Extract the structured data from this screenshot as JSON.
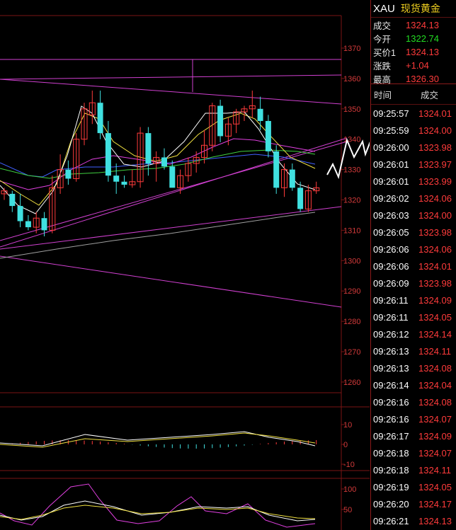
{
  "header": {
    "symbol": "XAU",
    "name": "现货黄金"
  },
  "quotes": [
    {
      "label": "成交",
      "value": "1324.13",
      "color": "#ff3b3b"
    },
    {
      "label": "今开",
      "value": "1322.74",
      "color": "#22dd22"
    },
    {
      "label": "买价1",
      "value": "1324.13",
      "color": "#ff3b3b"
    },
    {
      "label": "涨跌",
      "value": "+1.04",
      "color": "#ff3b3b"
    },
    {
      "label": "最高",
      "value": "1326.30",
      "color": "#ff3b3b"
    }
  ],
  "trades_header": {
    "time": "时间",
    "price": "成交"
  },
  "trades": [
    {
      "time": "09:25:57",
      "price": "1324.01"
    },
    {
      "time": "09:25:59",
      "price": "1324.00"
    },
    {
      "time": "09:26:00",
      "price": "1323.98"
    },
    {
      "time": "09:26:01",
      "price": "1323.97"
    },
    {
      "time": "09:26:01",
      "price": "1323.99"
    },
    {
      "time": "09:26:02",
      "price": "1324.06"
    },
    {
      "time": "09:26:03",
      "price": "1324.00"
    },
    {
      "time": "09:26:05",
      "price": "1323.98"
    },
    {
      "time": "09:26:06",
      "price": "1324.06"
    },
    {
      "time": "09:26:06",
      "price": "1324.01"
    },
    {
      "time": "09:26:09",
      "price": "1323.98"
    },
    {
      "time": "09:26:11",
      "price": "1324.09"
    },
    {
      "time": "09:26:11",
      "price": "1324.05"
    },
    {
      "time": "09:26:12",
      "price": "1324.14"
    },
    {
      "time": "09:26:13",
      "price": "1324.11"
    },
    {
      "time": "09:26:13",
      "price": "1324.08"
    },
    {
      "time": "09:26:14",
      "price": "1324.04"
    },
    {
      "time": "09:26:16",
      "price": "1324.08"
    },
    {
      "time": "09:26:16",
      "price": "1324.07"
    },
    {
      "time": "09:26:17",
      "price": "1324.09"
    },
    {
      "time": "09:26:18",
      "price": "1324.07"
    },
    {
      "time": "09:26:18",
      "price": "1324.11"
    },
    {
      "time": "09:26:19",
      "price": "1324.05"
    },
    {
      "time": "09:26:20",
      "price": "1324.17"
    },
    {
      "time": "09:26:21",
      "price": "1324.13"
    }
  ],
  "chart_data": {
    "type": "candlestick",
    "price_axis": {
      "ticks": [
        1370,
        1360,
        1350,
        1340,
        1330,
        1320,
        1310,
        1300,
        1290,
        1280,
        1270,
        1260
      ],
      "ylim": [
        1255,
        1378
      ]
    },
    "macd_axis": {
      "ticks": [
        10,
        0,
        -10
      ]
    },
    "osc_axis": {
      "ticks": [
        100,
        50
      ]
    },
    "colors": {
      "up": "#ff3b3b",
      "down": "#40e0e0",
      "grid": "#7a1515",
      "ma_white": "#ffffff",
      "ma_yellow": "#f0e040",
      "ma_green": "#40d040",
      "ma_blue": "#4060ff",
      "ma_magenta": "#e040e0",
      "ma_gray": "#a0a0a0",
      "trend": "#d040d0"
    },
    "candles": [
      {
        "o": 1322,
        "h": 1324,
        "l": 1320,
        "c": 1323
      },
      {
        "o": 1322,
        "h": 1323,
        "l": 1316,
        "c": 1318
      },
      {
        "o": 1318,
        "h": 1322,
        "l": 1311,
        "c": 1313
      },
      {
        "o": 1313,
        "h": 1315,
        "l": 1310,
        "c": 1311
      },
      {
        "o": 1311,
        "h": 1316,
        "l": 1309,
        "c": 1314
      },
      {
        "o": 1314,
        "h": 1316,
        "l": 1308,
        "c": 1310
      },
      {
        "o": 1310,
        "h": 1328,
        "l": 1309,
        "c": 1324
      },
      {
        "o": 1324,
        "h": 1335,
        "l": 1322,
        "c": 1330
      },
      {
        "o": 1330,
        "h": 1333,
        "l": 1325,
        "c": 1327
      },
      {
        "o": 1327,
        "h": 1342,
        "l": 1326,
        "c": 1340
      },
      {
        "o": 1340,
        "h": 1352,
        "l": 1338,
        "c": 1350
      },
      {
        "o": 1348,
        "h": 1356,
        "l": 1345,
        "c": 1352
      },
      {
        "o": 1352,
        "h": 1356,
        "l": 1340,
        "c": 1342
      },
      {
        "o": 1342,
        "h": 1346,
        "l": 1326,
        "c": 1328
      },
      {
        "o": 1328,
        "h": 1332,
        "l": 1322,
        "c": 1326
      },
      {
        "o": 1326,
        "h": 1328,
        "l": 1324,
        "c": 1325
      },
      {
        "o": 1325,
        "h": 1330,
        "l": 1324,
        "c": 1326
      },
      {
        "o": 1326,
        "h": 1344,
        "l": 1324,
        "c": 1342
      },
      {
        "o": 1342,
        "h": 1344,
        "l": 1328,
        "c": 1332
      },
      {
        "o": 1332,
        "h": 1336,
        "l": 1326,
        "c": 1334
      },
      {
        "o": 1334,
        "h": 1337,
        "l": 1330,
        "c": 1331
      },
      {
        "o": 1331,
        "h": 1333,
        "l": 1326,
        "c": 1324
      },
      {
        "o": 1324,
        "h": 1330,
        "l": 1322,
        "c": 1328
      },
      {
        "o": 1328,
        "h": 1334,
        "l": 1326,
        "c": 1332
      },
      {
        "o": 1332,
        "h": 1336,
        "l": 1329,
        "c": 1334
      },
      {
        "o": 1334,
        "h": 1343,
        "l": 1332,
        "c": 1338
      },
      {
        "o": 1338,
        "h": 1352,
        "l": 1336,
        "c": 1351
      },
      {
        "o": 1351,
        "h": 1353,
        "l": 1339,
        "c": 1341
      },
      {
        "o": 1341,
        "h": 1347,
        "l": 1338,
        "c": 1345
      },
      {
        "o": 1345,
        "h": 1350,
        "l": 1342,
        "c": 1349
      },
      {
        "o": 1349,
        "h": 1351,
        "l": 1346,
        "c": 1350
      },
      {
        "o": 1350,
        "h": 1356,
        "l": 1347,
        "c": 1351
      },
      {
        "o": 1350,
        "h": 1354,
        "l": 1343,
        "c": 1346
      },
      {
        "o": 1346,
        "h": 1348,
        "l": 1334,
        "c": 1336
      },
      {
        "o": 1336,
        "h": 1338,
        "l": 1322,
        "c": 1324
      },
      {
        "o": 1324,
        "h": 1332,
        "l": 1321,
        "c": 1330
      },
      {
        "o": 1330,
        "h": 1332,
        "l": 1323,
        "c": 1324
      },
      {
        "o": 1324,
        "h": 1326,
        "l": 1316,
        "c": 1317
      },
      {
        "o": 1317,
        "h": 1325,
        "l": 1316,
        "c": 1323
      },
      {
        "o": 1323,
        "h": 1326,
        "l": 1322,
        "c": 1324
      }
    ]
  }
}
